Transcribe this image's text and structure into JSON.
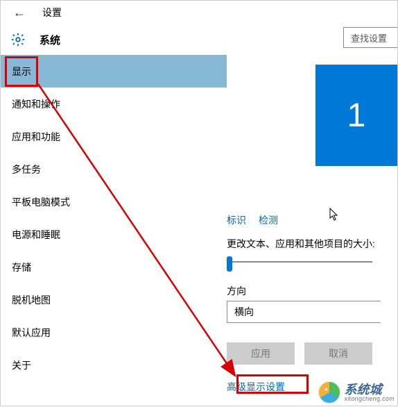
{
  "header": {
    "window_title": "设置",
    "section_title": "系统",
    "search_placeholder": "查找设置"
  },
  "sidebar": {
    "items": [
      {
        "label": "显示",
        "selected": true
      },
      {
        "label": "通知和操作",
        "selected": false
      },
      {
        "label": "应用和功能",
        "selected": false
      },
      {
        "label": "多任务",
        "selected": false
      },
      {
        "label": "平板电脑模式",
        "selected": false
      },
      {
        "label": "电源和睡眠",
        "selected": false
      },
      {
        "label": "存储",
        "selected": false
      },
      {
        "label": "脱机地图",
        "selected": false
      },
      {
        "label": "默认应用",
        "selected": false
      },
      {
        "label": "关于",
        "selected": false
      }
    ]
  },
  "content": {
    "monitor_number": "1",
    "identify_link": "标识",
    "detect_link": "检测",
    "size_label": "更改文本、应用和其他项目的大小:",
    "direction_label": "方向",
    "direction_value": "横向",
    "apply_button": "应用",
    "cancel_button": "取消",
    "advanced_link": "高级显示设置"
  },
  "watermark": {
    "cn": "系统城",
    "en": "xitongcheng.com"
  },
  "annotations": {
    "highlight_nav": "显示",
    "highlight_link": "高级显示设置",
    "colors": {
      "accent": "#0078d7",
      "link": "#0068b3",
      "highlight": "#d60000"
    }
  }
}
